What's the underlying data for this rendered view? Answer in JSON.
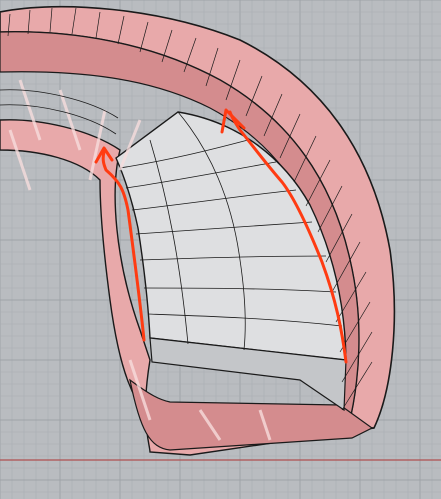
{
  "viewport": {
    "background": "#b9bcc0",
    "grid_minor_color": "#a9adb2",
    "grid_major_color": "#9ea3a8",
    "axis_color": "#b05050"
  },
  "model": {
    "surface_color": "#e8a9aa",
    "surface_shade": "#d48c8e",
    "highlight_color": "#f6dcdc",
    "edge_color": "#1a1a1a",
    "selected_face_color": "#dedfe1",
    "selected_face_side": "#c4c6c9"
  },
  "annotations": {
    "stroke_color": "#ff3b12",
    "arrow_count": 2
  }
}
